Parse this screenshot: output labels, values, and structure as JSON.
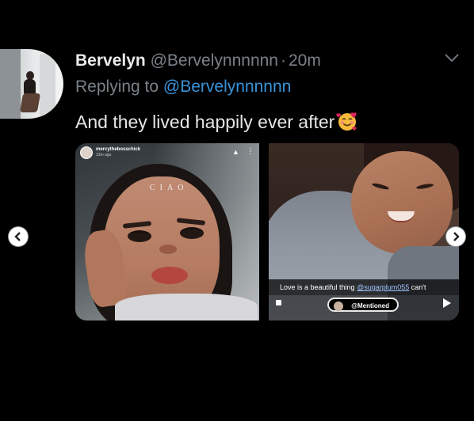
{
  "tweet": {
    "display_name": "Bervelyn",
    "handle": "@Bervelynnnnnn",
    "separator": "·",
    "time": "20m",
    "replying_prefix": "Replying to ",
    "replying_handle": "@Bervelynnnnnn",
    "text": "And they lived happily ever after",
    "emoji": "smiling-face-with-hearts-icon"
  },
  "media": {
    "left_story": {
      "username": "mercythebosschick",
      "posted_ago": "13m ago",
      "sticker_text": "CIAO"
    },
    "right_story": {
      "caption_text": "Love is a beautiful thing ",
      "caption_tag": "@sugarplum055",
      "caption_rest": " can't",
      "mention_label": "@Mentioned"
    }
  },
  "nav": {
    "prev_icon": "chevron-left-icon",
    "next_icon": "chevron-right-icon"
  },
  "colors": {
    "background": "#000000",
    "name": "#ebebeb",
    "muted": "#7a8187",
    "link": "#3a93d8",
    "text": "#e6e6e6"
  }
}
